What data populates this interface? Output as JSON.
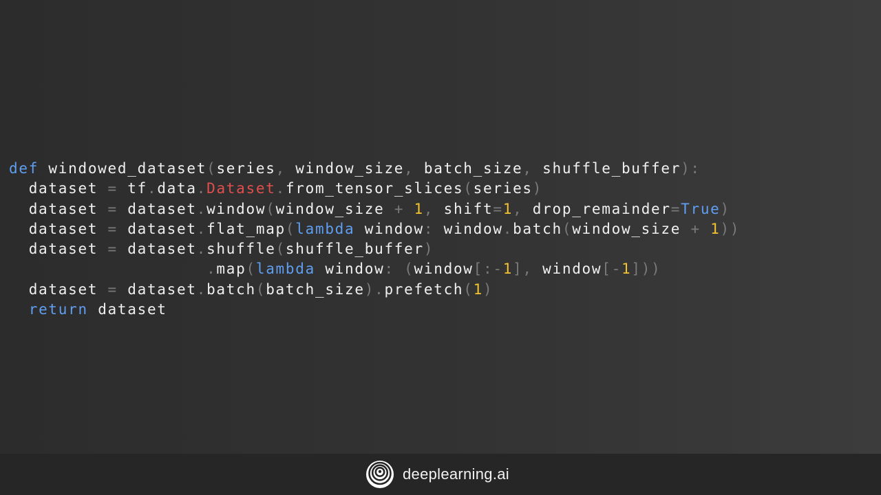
{
  "code_lines": [
    [
      {
        "text": "def",
        "kind": "keyword"
      },
      {
        "text": " windowed_dataset",
        "kind": "plain"
      },
      {
        "text": "(",
        "kind": "punctuation"
      },
      {
        "text": "series",
        "kind": "plain"
      },
      {
        "text": ",",
        "kind": "punctuation"
      },
      {
        "text": " window_size",
        "kind": "plain"
      },
      {
        "text": ",",
        "kind": "punctuation"
      },
      {
        "text": " batch_size",
        "kind": "plain"
      },
      {
        "text": ",",
        "kind": "punctuation"
      },
      {
        "text": " shuffle_buffer",
        "kind": "plain"
      },
      {
        "text": "):",
        "kind": "punctuation"
      }
    ],
    [
      {
        "text": "  dataset ",
        "kind": "plain"
      },
      {
        "text": "=",
        "kind": "punctuation"
      },
      {
        "text": " tf",
        "kind": "plain"
      },
      {
        "text": ".",
        "kind": "punctuation"
      },
      {
        "text": "data",
        "kind": "plain"
      },
      {
        "text": ".",
        "kind": "punctuation"
      },
      {
        "text": "Dataset",
        "kind": "class"
      },
      {
        "text": ".",
        "kind": "punctuation"
      },
      {
        "text": "from_tensor_slices",
        "kind": "plain"
      },
      {
        "text": "(",
        "kind": "punctuation"
      },
      {
        "text": "series",
        "kind": "plain"
      },
      {
        "text": ")",
        "kind": "punctuation"
      }
    ],
    [
      {
        "text": "  dataset ",
        "kind": "plain"
      },
      {
        "text": "=",
        "kind": "punctuation"
      },
      {
        "text": " dataset",
        "kind": "plain"
      },
      {
        "text": ".",
        "kind": "punctuation"
      },
      {
        "text": "window",
        "kind": "plain"
      },
      {
        "text": "(",
        "kind": "punctuation"
      },
      {
        "text": "window_size ",
        "kind": "plain"
      },
      {
        "text": "+",
        "kind": "punctuation"
      },
      {
        "text": " ",
        "kind": "plain"
      },
      {
        "text": "1",
        "kind": "number"
      },
      {
        "text": ",",
        "kind": "punctuation"
      },
      {
        "text": " shift",
        "kind": "plain"
      },
      {
        "text": "=",
        "kind": "punctuation"
      },
      {
        "text": "1",
        "kind": "number"
      },
      {
        "text": ",",
        "kind": "punctuation"
      },
      {
        "text": " drop_remainder",
        "kind": "plain"
      },
      {
        "text": "=",
        "kind": "punctuation"
      },
      {
        "text": "True",
        "kind": "keyword"
      },
      {
        "text": ")",
        "kind": "punctuation"
      }
    ],
    [
      {
        "text": "  dataset ",
        "kind": "plain"
      },
      {
        "text": "=",
        "kind": "punctuation"
      },
      {
        "text": " dataset",
        "kind": "plain"
      },
      {
        "text": ".",
        "kind": "punctuation"
      },
      {
        "text": "flat_map",
        "kind": "plain"
      },
      {
        "text": "(",
        "kind": "punctuation"
      },
      {
        "text": "lambda",
        "kind": "keyword"
      },
      {
        "text": " window",
        "kind": "plain"
      },
      {
        "text": ":",
        "kind": "punctuation"
      },
      {
        "text": " window",
        "kind": "plain"
      },
      {
        "text": ".",
        "kind": "punctuation"
      },
      {
        "text": "batch",
        "kind": "plain"
      },
      {
        "text": "(",
        "kind": "punctuation"
      },
      {
        "text": "window_size ",
        "kind": "plain"
      },
      {
        "text": "+",
        "kind": "punctuation"
      },
      {
        "text": " ",
        "kind": "plain"
      },
      {
        "text": "1",
        "kind": "number"
      },
      {
        "text": "))",
        "kind": "punctuation"
      }
    ],
    [
      {
        "text": "  dataset ",
        "kind": "plain"
      },
      {
        "text": "=",
        "kind": "punctuation"
      },
      {
        "text": " dataset",
        "kind": "plain"
      },
      {
        "text": ".",
        "kind": "punctuation"
      },
      {
        "text": "shuffle",
        "kind": "plain"
      },
      {
        "text": "(",
        "kind": "punctuation"
      },
      {
        "text": "shuffle_buffer",
        "kind": "plain"
      },
      {
        "text": ")",
        "kind": "punctuation"
      }
    ],
    [
      {
        "text": "                    ",
        "kind": "plain"
      },
      {
        "text": ".",
        "kind": "punctuation"
      },
      {
        "text": "map",
        "kind": "plain"
      },
      {
        "text": "(",
        "kind": "punctuation"
      },
      {
        "text": "lambda",
        "kind": "keyword"
      },
      {
        "text": " window",
        "kind": "plain"
      },
      {
        "text": ":",
        "kind": "punctuation"
      },
      {
        "text": " ",
        "kind": "plain"
      },
      {
        "text": "(",
        "kind": "punctuation"
      },
      {
        "text": "window",
        "kind": "plain"
      },
      {
        "text": "[:-",
        "kind": "punctuation"
      },
      {
        "text": "1",
        "kind": "number"
      },
      {
        "text": "],",
        "kind": "punctuation"
      },
      {
        "text": " window",
        "kind": "plain"
      },
      {
        "text": "[-",
        "kind": "punctuation"
      },
      {
        "text": "1",
        "kind": "number"
      },
      {
        "text": "]))",
        "kind": "punctuation"
      }
    ],
    [
      {
        "text": "  dataset ",
        "kind": "plain"
      },
      {
        "text": "=",
        "kind": "punctuation"
      },
      {
        "text": " dataset",
        "kind": "plain"
      },
      {
        "text": ".",
        "kind": "punctuation"
      },
      {
        "text": "batch",
        "kind": "plain"
      },
      {
        "text": "(",
        "kind": "punctuation"
      },
      {
        "text": "batch_size",
        "kind": "plain"
      },
      {
        "text": ").",
        "kind": "punctuation"
      },
      {
        "text": "prefetch",
        "kind": "plain"
      },
      {
        "text": "(",
        "kind": "punctuation"
      },
      {
        "text": "1",
        "kind": "number"
      },
      {
        "text": ")",
        "kind": "punctuation"
      }
    ],
    [
      {
        "text": "  ",
        "kind": "plain"
      },
      {
        "text": "return",
        "kind": "keyword"
      },
      {
        "text": " dataset",
        "kind": "plain"
      }
    ]
  ],
  "syntax_colors": {
    "plain": "#f0f0f0",
    "keyword": "#5f9ef0",
    "number": "#f2c230",
    "class": "#e04e4e",
    "punctuation": "#7a7a7a"
  },
  "footer": {
    "logo_icon": "deeplearning-ai-logo-icon",
    "brand_name": "deeplearning.ai",
    "background": "#262626"
  },
  "background": "#333333"
}
